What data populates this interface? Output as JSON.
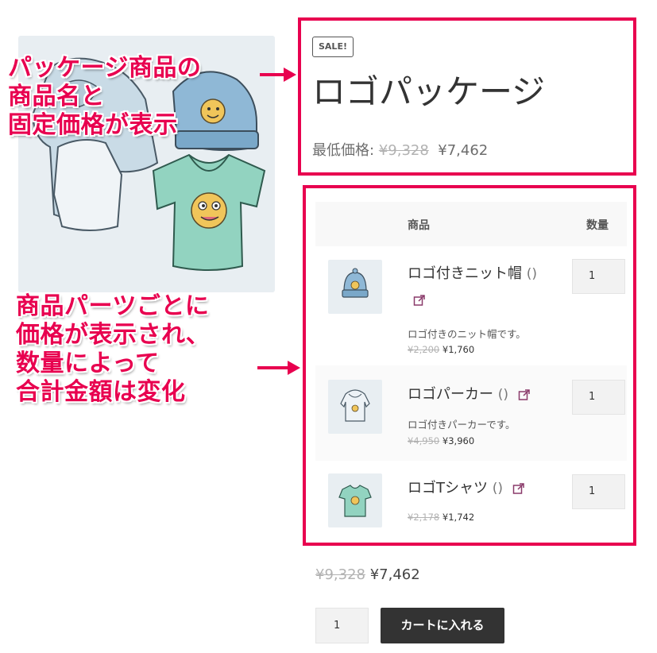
{
  "annotations": {
    "top_caption": [
      "パッケージ商品の",
      "商品名と",
      "固定価格が表示"
    ],
    "bottom_caption": [
      "商品パーツごとに",
      "価格が表示され、",
      "数量によって",
      "合計金額は変化"
    ],
    "accent_color": "#e8004f"
  },
  "product": {
    "badge": "SALE!",
    "title": "ロゴパッケージ",
    "price_label": "最低価格:",
    "regular_price": "¥9,328",
    "sale_price": "¥7,462"
  },
  "bundle": {
    "headers": {
      "product": "商品",
      "quantity": "数量"
    },
    "items": [
      {
        "name": "ロゴ付きニット帽",
        "paren": "()",
        "description": "ロゴ付きのニット帽です。",
        "regular_price": "¥2,200",
        "sale_price": "¥1,760",
        "qty": "1",
        "thumb_icon": "beanie-icon"
      },
      {
        "name": "ロゴパーカー",
        "paren": "()",
        "description": "ロゴ付きパーカーです。",
        "regular_price": "¥4,950",
        "sale_price": "¥3,960",
        "qty": "1",
        "thumb_icon": "hoodie-icon"
      },
      {
        "name": "ロゴTシャツ",
        "paren": "()",
        "description": "",
        "regular_price": "¥2,178",
        "sale_price": "¥1,742",
        "qty": "1",
        "thumb_icon": "tshirt-icon"
      }
    ]
  },
  "totals": {
    "regular_price": "¥9,328",
    "sale_price": "¥7,462",
    "qty": "1",
    "add_to_cart_label": "カートに入れる"
  }
}
